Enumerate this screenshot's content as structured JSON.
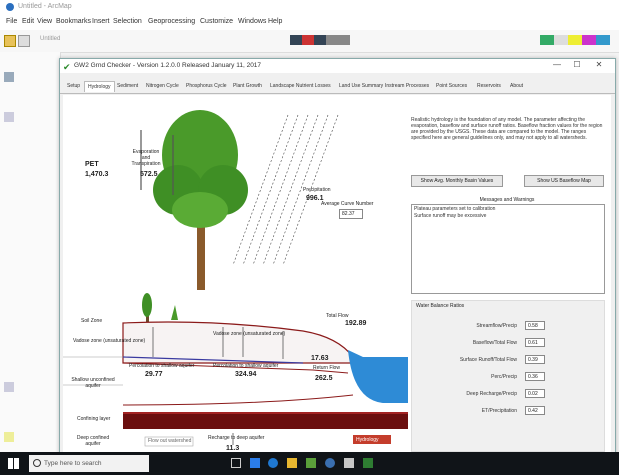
{
  "host": {
    "title": "Untitled - ArcMap",
    "menu": [
      "File",
      "Edit",
      "View",
      "Bookmarks",
      "Insert",
      "Selection",
      "Geoprocessing",
      "Customize",
      "Windows",
      "Help"
    ],
    "mini_title": "Untitled"
  },
  "dialog": {
    "title": "GW2 Grnd Checker - Version 1.2.0.0 Released January 11, 2017",
    "tabs": [
      "Setup",
      "Hydrology",
      "Sediment",
      "Nitrogen Cycle",
      "Phosphorus Cycle",
      "Plant Growth",
      "Landscape Nutrient Losses",
      "Land Use Summary",
      "Instream Processes",
      "Point Sources",
      "Reservoirs",
      "About"
    ],
    "active_tab": 1
  },
  "diagram": {
    "pet_label": "PET",
    "pet_value": "1,470.3",
    "et_label": "Evaporation and Transpiration",
    "et_value": "572.5",
    "precip_label": "Precipitation",
    "precip_value": "996.1",
    "cn_label": "Average Curve Number",
    "cn_value": "82.37",
    "total_flow_value": "192.89",
    "total_flow_label": "Total Flow",
    "soil_zone": "Soil Zone",
    "shallow_unsat": "Vadose zone (unsaturated zone)",
    "shallow_aquifer": "Shallow unconfined aquifer",
    "confining": "Confining layer",
    "deep_aquifer": "Deep confined aquifer",
    "recharge_label": "Percolation to shallow aquifer",
    "recharge_value": "29.77",
    "lateral_label": "Percolation to shallow aquifer",
    "lateral_value": "324.94",
    "baseflow_label": "Return Flow",
    "baseflow_value": "262.5",
    "surface_runoff_value": "17.63",
    "deep_recharge_label": "Recharge to deep aquifer",
    "deep_recharge_value": "11.3",
    "flow_out_label": "Flow out watershed",
    "warning_badge": "Hydrology"
  },
  "info_text": "Realistic hydrology is the foundation of any model. The parameter affecting the evaporation, baseflow and surface runoff ratios. Baseflow fraction values for the region are provided by the USGS. These data are compared to the model. The ranges specified here are general guidelines only, and may not apply to all watersheds.",
  "buttons": {
    "avg_monthly": "Show Avg. Monthly Basin Values",
    "usgs_baseflow": "Show US Baseflow Map"
  },
  "messages": {
    "title": "Messages and Warnings",
    "lines": [
      "Plateau parameters set to calibration",
      "Surface runoff may be excessive"
    ]
  },
  "water_balance": {
    "title": "Water Balance Ratios",
    "rows": [
      {
        "label": "Streamflow/Precip",
        "value": "0.58"
      },
      {
        "label": "Baseflow/Total Flow",
        "value": "0.61"
      },
      {
        "label": "Surface Runoff/Total Flow",
        "value": "0.39"
      },
      {
        "label": "Perc/Precip",
        "value": "0.36"
      },
      {
        "label": "Deep Recharge/Precip",
        "value": "0.02"
      },
      {
        "label": "ET/Precipitation",
        "value": "0.42"
      }
    ]
  },
  "taskbar": {
    "search_placeholder": "Type here to search"
  }
}
